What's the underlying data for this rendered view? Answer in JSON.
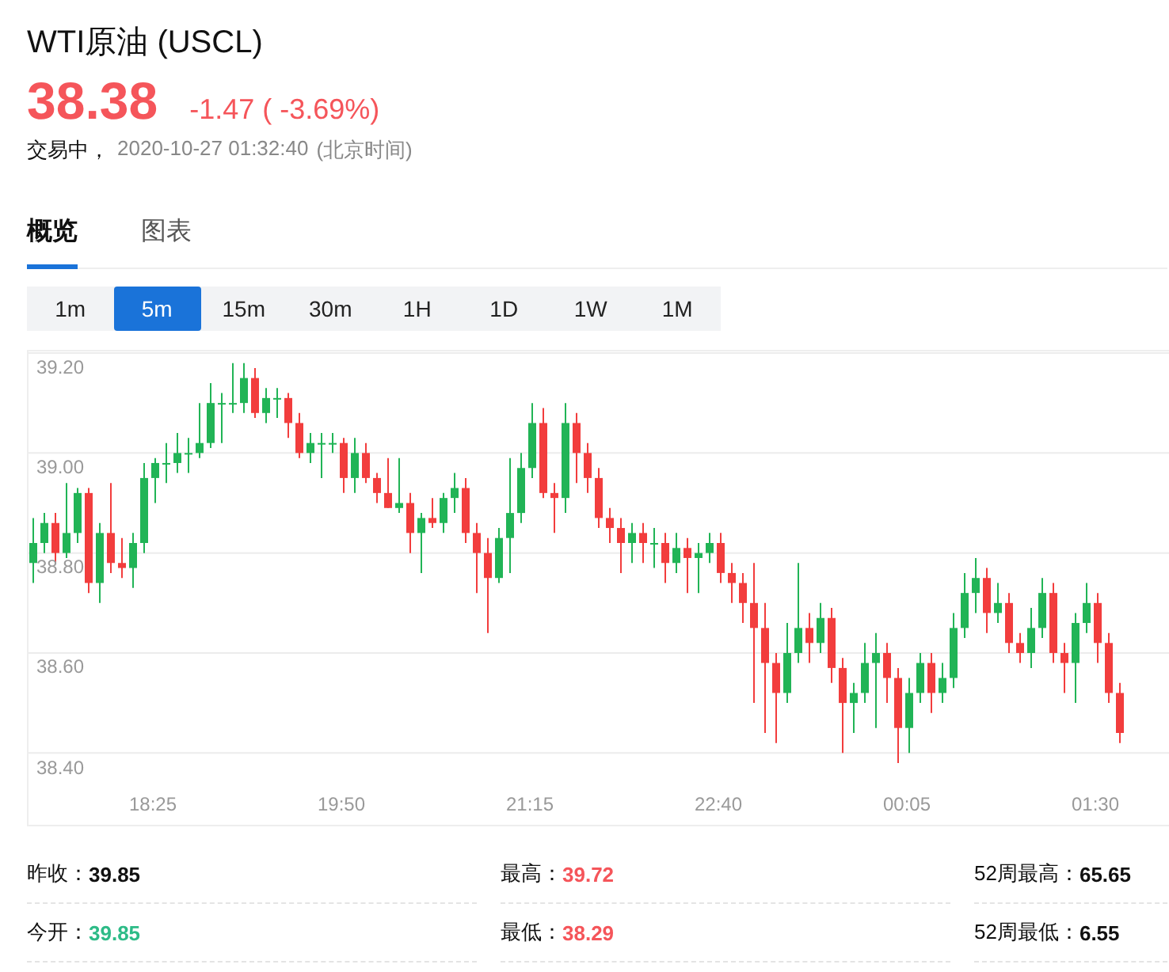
{
  "header": {
    "title": "WTI原油 (USCL)",
    "price": "38.38",
    "change": "-1.47 ( -3.69%)",
    "color": "#f5555a",
    "status": "交易中，",
    "time": "2020-10-27 01:32:40",
    "timezone": "(北京时间)"
  },
  "tabs": [
    {
      "label": "概览",
      "selected": true
    },
    {
      "label": "图表",
      "selected": false
    }
  ],
  "periods": [
    {
      "label": "1m",
      "selected": false
    },
    {
      "label": "5m",
      "selected": true
    },
    {
      "label": "15m",
      "selected": false
    },
    {
      "label": "30m",
      "selected": false
    },
    {
      "label": "1H",
      "selected": false
    },
    {
      "label": "1D",
      "selected": false
    },
    {
      "label": "1W",
      "selected": false
    },
    {
      "label": "1M",
      "selected": false
    }
  ],
  "chart_data": {
    "type": "candlestick",
    "ylim": [
      38.25,
      39.2
    ],
    "grid": true,
    "yticks": [
      {
        "value": 39.2,
        "label": "39.20"
      },
      {
        "value": 39.0,
        "label": "39.00"
      },
      {
        "value": 38.8,
        "label": "38.80"
      },
      {
        "value": 38.6,
        "label": "38.60"
      },
      {
        "value": 38.4,
        "label": "38.40"
      }
    ],
    "categories": [
      null,
      null,
      null,
      null,
      null,
      null,
      null,
      null,
      null,
      null,
      null,
      "18:25",
      null,
      null,
      null,
      null,
      null,
      null,
      null,
      null,
      null,
      null,
      null,
      null,
      null,
      null,
      null,
      null,
      "19:50",
      null,
      null,
      null,
      null,
      null,
      null,
      null,
      null,
      null,
      null,
      null,
      null,
      null,
      null,
      null,
      null,
      "21:15",
      null,
      null,
      null,
      null,
      null,
      null,
      null,
      null,
      null,
      null,
      null,
      null,
      null,
      null,
      null,
      null,
      "22:40",
      null,
      null,
      null,
      null,
      null,
      null,
      null,
      null,
      null,
      null,
      null,
      null,
      null,
      null,
      null,
      null,
      "00:05",
      null,
      null,
      null,
      null,
      null,
      null,
      null,
      null,
      null,
      null,
      null,
      null,
      null,
      null,
      null,
      null,
      "01:30",
      null,
      null
    ],
    "ohlc": [
      [
        38.78,
        38.87,
        38.74,
        38.82
      ],
      [
        38.82,
        38.88,
        38.8,
        38.86
      ],
      [
        38.86,
        38.88,
        38.78,
        38.8
      ],
      [
        38.8,
        38.94,
        38.79,
        38.84
      ],
      [
        38.84,
        38.93,
        38.82,
        38.92
      ],
      [
        38.92,
        38.93,
        38.72,
        38.74
      ],
      [
        38.74,
        38.86,
        38.7,
        38.84
      ],
      [
        38.84,
        38.94,
        38.76,
        38.78
      ],
      [
        38.78,
        38.83,
        38.75,
        38.77
      ],
      [
        38.77,
        38.84,
        38.73,
        38.82
      ],
      [
        38.82,
        38.98,
        38.8,
        38.95
      ],
      [
        38.95,
        38.99,
        38.9,
        38.98
      ],
      [
        38.98,
        39.02,
        38.94,
        38.98
      ],
      [
        38.98,
        39.04,
        38.96,
        39.0
      ],
      [
        39.0,
        39.03,
        38.96,
        39.0
      ],
      [
        39.0,
        39.1,
        38.99,
        39.02
      ],
      [
        39.02,
        39.14,
        39.01,
        39.1
      ],
      [
        39.1,
        39.12,
        39.02,
        39.1
      ],
      [
        39.1,
        39.18,
        39.08,
        39.1
      ],
      [
        39.1,
        39.18,
        39.08,
        39.15
      ],
      [
        39.15,
        39.17,
        39.07,
        39.08
      ],
      [
        39.08,
        39.13,
        39.06,
        39.11
      ],
      [
        39.11,
        39.13,
        39.07,
        39.11
      ],
      [
        39.11,
        39.12,
        39.03,
        39.06
      ],
      [
        39.06,
        39.08,
        38.99,
        39.0
      ],
      [
        39.0,
        39.04,
        38.98,
        39.02
      ],
      [
        39.02,
        39.04,
        38.95,
        39.02
      ],
      [
        39.02,
        39.04,
        39.0,
        39.02
      ],
      [
        39.02,
        39.03,
        38.92,
        38.95
      ],
      [
        38.95,
        39.03,
        38.92,
        39.0
      ],
      [
        39.0,
        39.02,
        38.94,
        38.95
      ],
      [
        38.95,
        38.96,
        38.9,
        38.92
      ],
      [
        38.92,
        38.99,
        38.89,
        38.89
      ],
      [
        38.89,
        38.99,
        38.88,
        38.9
      ],
      [
        38.9,
        38.92,
        38.8,
        38.84
      ],
      [
        38.84,
        38.88,
        38.76,
        38.87
      ],
      [
        38.87,
        38.91,
        38.85,
        38.86
      ],
      [
        38.86,
        38.92,
        38.84,
        38.91
      ],
      [
        38.91,
        38.96,
        38.88,
        38.93
      ],
      [
        38.93,
        38.95,
        38.82,
        38.84
      ],
      [
        38.84,
        38.86,
        38.72,
        38.8
      ],
      [
        38.8,
        38.83,
        38.64,
        38.75
      ],
      [
        38.75,
        38.85,
        38.74,
        38.83
      ],
      [
        38.83,
        38.99,
        38.76,
        38.88
      ],
      [
        38.88,
        39.0,
        38.86,
        38.97
      ],
      [
        38.97,
        39.1,
        38.95,
        39.06
      ],
      [
        39.06,
        39.09,
        38.91,
        38.92
      ],
      [
        38.92,
        38.94,
        38.84,
        38.91
      ],
      [
        38.91,
        39.1,
        38.88,
        39.06
      ],
      [
        39.06,
        39.08,
        38.94,
        39.0
      ],
      [
        39.0,
        39.02,
        38.92,
        38.95
      ],
      [
        38.95,
        38.97,
        38.85,
        38.87
      ],
      [
        38.87,
        38.89,
        38.82,
        38.85
      ],
      [
        38.85,
        38.87,
        38.76,
        38.82
      ],
      [
        38.82,
        38.86,
        38.78,
        38.84
      ],
      [
        38.84,
        38.86,
        38.78,
        38.82
      ],
      [
        38.82,
        38.85,
        38.77,
        38.82
      ],
      [
        38.82,
        38.84,
        38.74,
        38.78
      ],
      [
        38.78,
        38.84,
        38.76,
        38.81
      ],
      [
        38.81,
        38.83,
        38.72,
        38.79
      ],
      [
        38.79,
        38.82,
        38.72,
        38.8
      ],
      [
        38.8,
        38.84,
        38.78,
        38.82
      ],
      [
        38.82,
        38.84,
        38.74,
        38.76
      ],
      [
        38.76,
        38.78,
        38.7,
        38.74
      ],
      [
        38.74,
        38.76,
        38.66,
        38.7
      ],
      [
        38.7,
        38.78,
        38.5,
        38.65
      ],
      [
        38.65,
        38.7,
        38.44,
        38.58
      ],
      [
        38.58,
        38.6,
        38.42,
        38.52
      ],
      [
        38.52,
        38.66,
        38.5,
        38.6
      ],
      [
        38.6,
        38.78,
        38.58,
        38.65
      ],
      [
        38.65,
        38.68,
        38.58,
        38.62
      ],
      [
        38.62,
        38.7,
        38.6,
        38.67
      ],
      [
        38.67,
        38.69,
        38.54,
        38.57
      ],
      [
        38.57,
        38.59,
        38.4,
        38.5
      ],
      [
        38.5,
        38.54,
        38.44,
        38.52
      ],
      [
        38.52,
        38.62,
        38.5,
        38.58
      ],
      [
        38.58,
        38.64,
        38.45,
        38.6
      ],
      [
        38.6,
        38.62,
        38.5,
        38.55
      ],
      [
        38.55,
        38.57,
        38.38,
        38.45
      ],
      [
        38.45,
        38.55,
        38.4,
        38.52
      ],
      [
        38.52,
        38.6,
        38.5,
        38.58
      ],
      [
        38.58,
        38.6,
        38.48,
        38.52
      ],
      [
        38.52,
        38.58,
        38.5,
        38.55
      ],
      [
        38.55,
        38.68,
        38.53,
        38.65
      ],
      [
        38.65,
        38.76,
        38.63,
        38.72
      ],
      [
        38.72,
        38.79,
        38.68,
        38.75
      ],
      [
        38.75,
        38.77,
        38.64,
        38.68
      ],
      [
        38.68,
        38.74,
        38.66,
        38.7
      ],
      [
        38.7,
        38.72,
        38.6,
        38.62
      ],
      [
        38.62,
        38.64,
        38.58,
        38.6
      ],
      [
        38.6,
        38.69,
        38.57,
        38.65
      ],
      [
        38.65,
        38.75,
        38.63,
        38.72
      ],
      [
        38.72,
        38.74,
        38.58,
        38.6
      ],
      [
        38.6,
        38.62,
        38.52,
        38.58
      ],
      [
        38.58,
        38.68,
        38.5,
        38.66
      ],
      [
        38.66,
        38.74,
        38.64,
        38.7
      ],
      [
        38.7,
        38.72,
        38.58,
        38.62
      ],
      [
        38.62,
        38.64,
        38.5,
        38.52
      ],
      [
        38.52,
        38.54,
        38.42,
        38.44
      ]
    ]
  },
  "stats": [
    {
      "label": "昨收：",
      "value": "39.85",
      "color": "#111111"
    },
    {
      "label": "最高：",
      "value": "39.72",
      "color": "#f5555a"
    },
    {
      "label": "52周最高：",
      "value": "65.65",
      "color": "#111111"
    },
    {
      "label": "今开：",
      "value": "39.85",
      "color": "#2dbb87"
    },
    {
      "label": "最低：",
      "value": "38.29",
      "color": "#f5555a"
    },
    {
      "label": "52周最低：",
      "value": "6.55",
      "color": "#111111"
    }
  ]
}
